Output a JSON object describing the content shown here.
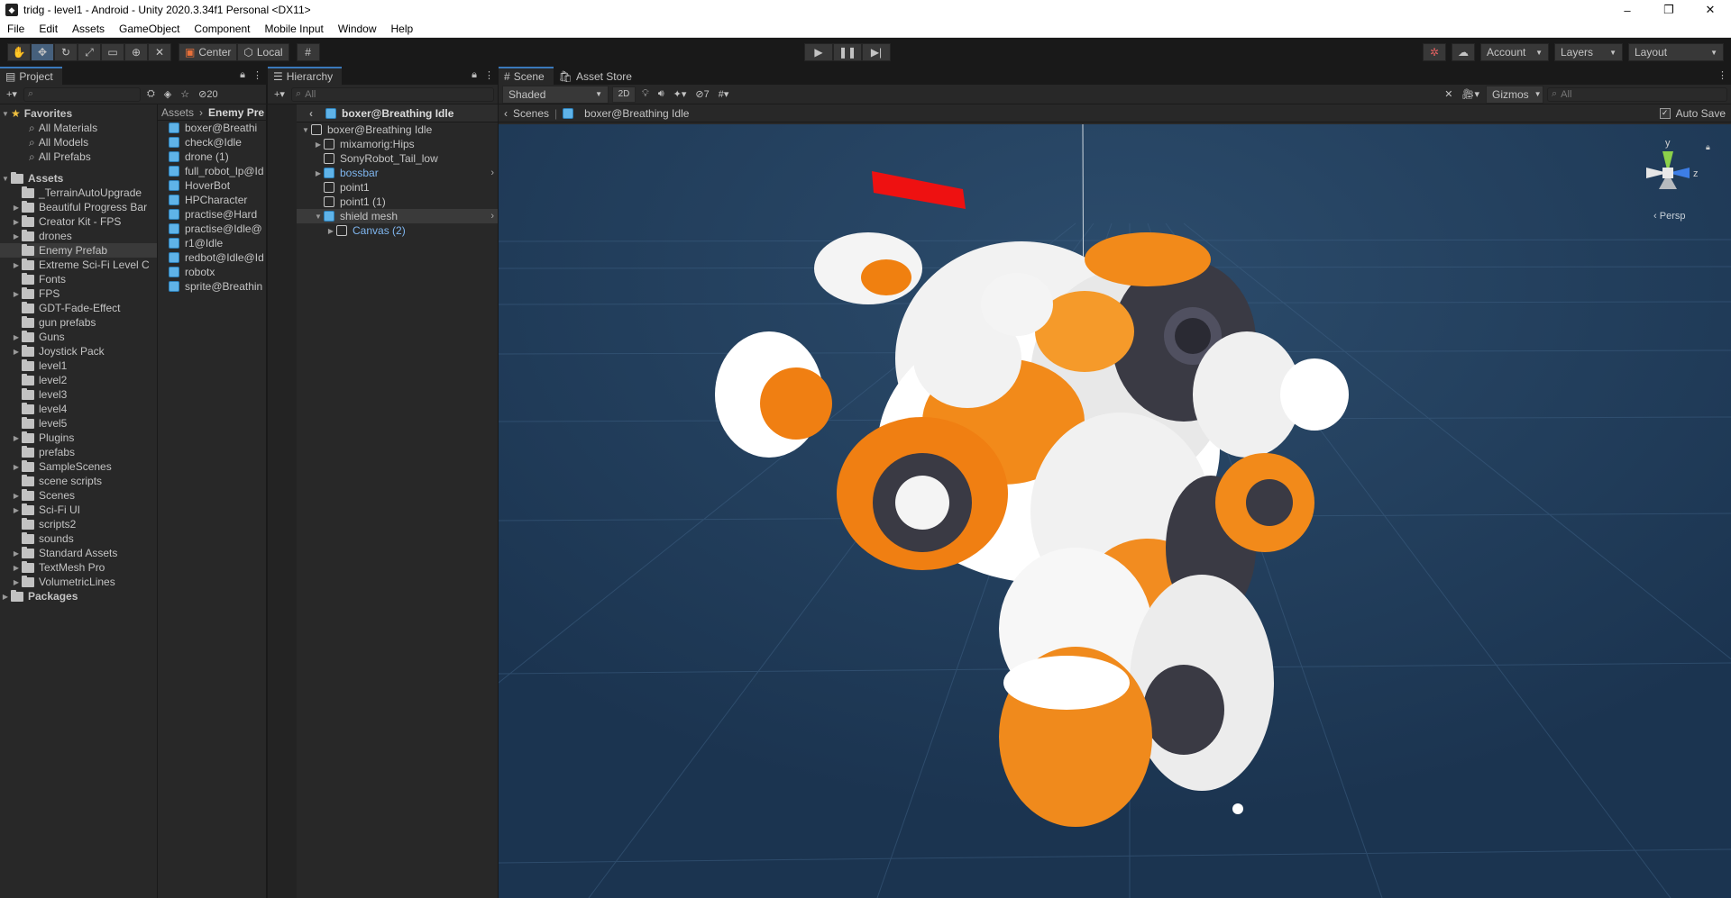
{
  "window": {
    "title": "tridg - level1 - Android - Unity 2020.3.34f1 Personal <DX11>",
    "controls": [
      "–",
      "❐",
      "✕"
    ]
  },
  "menu": [
    "File",
    "Edit",
    "Assets",
    "GameObject",
    "Component",
    "Mobile Input",
    "Window",
    "Help"
  ],
  "toolbar": {
    "pivot": "Center",
    "space": "Local",
    "account": "Account",
    "layers": "Layers",
    "layout": "Layout"
  },
  "project": {
    "tab": "Project",
    "hidden_count": "20",
    "search_placeholder": "",
    "favorites_label": "Favorites",
    "favorites": [
      "All Materials",
      "All Models",
      "All Prefabs"
    ],
    "assets_label": "Assets",
    "folders": [
      "_TerrainAutoUpgrade",
      "Beautiful Progress Bar",
      "Creator Kit - FPS",
      "drones",
      "Enemy Prefab",
      "Extreme Sci-Fi Level C",
      "Fonts",
      "FPS",
      "GDT-Fade-Effect",
      "gun prefabs",
      "Guns",
      "Joystick Pack",
      "level1",
      "level2",
      "level3",
      "level4",
      "level5",
      "Plugins",
      "prefabs",
      "SampleScenes",
      "scene scripts",
      "Scenes",
      "Sci-Fi UI",
      "scripts2",
      "sounds",
      "Standard Assets",
      "TextMesh Pro",
      "VolumetricLines"
    ],
    "packages_label": "Packages",
    "breadcrumb_root": "Assets",
    "breadcrumb_current": "Enemy Pre",
    "files": [
      "boxer@Breathi",
      "check@Idle",
      "drone (1)",
      "full_robot_lp@Id",
      "HoverBot",
      "HPCharacter",
      "practise@Hard",
      "practise@Idle@",
      "r1@Idle",
      "redbot@Idle@Id",
      "robotx",
      "sprite@Breathin"
    ]
  },
  "hierarchy": {
    "tab": "Hierarchy",
    "search_placeholder": "All",
    "scene_title": "boxer@Breathing Idle",
    "items": [
      {
        "label": "boxer@Breathing Idle",
        "indent": 0
      },
      {
        "label": "mixamorig:Hips",
        "indent": 1
      },
      {
        "label": "SonyRobot_Tail_low",
        "indent": 1
      },
      {
        "label": "bossbar",
        "indent": 1
      },
      {
        "label": "point1",
        "indent": 1
      },
      {
        "label": "point1 (1)",
        "indent": 1
      },
      {
        "label": "shield mesh",
        "indent": 1
      },
      {
        "label": "Canvas (2)",
        "indent": 2
      }
    ]
  },
  "scene": {
    "tab_scene": "Scene",
    "tab_store": "Asset Store",
    "shading": "Shaded",
    "mode_2d": "2D",
    "hidden_count": "7",
    "gizmos": "Gizmos",
    "search_placeholder": "All",
    "crumb_root": "Scenes",
    "crumb_current": "boxer@Breathing Idle",
    "auto_save": "Auto Save",
    "persp": "Persp",
    "axis_y": "y",
    "axis_z": "z",
    "bg_color": "#1f3a55"
  }
}
